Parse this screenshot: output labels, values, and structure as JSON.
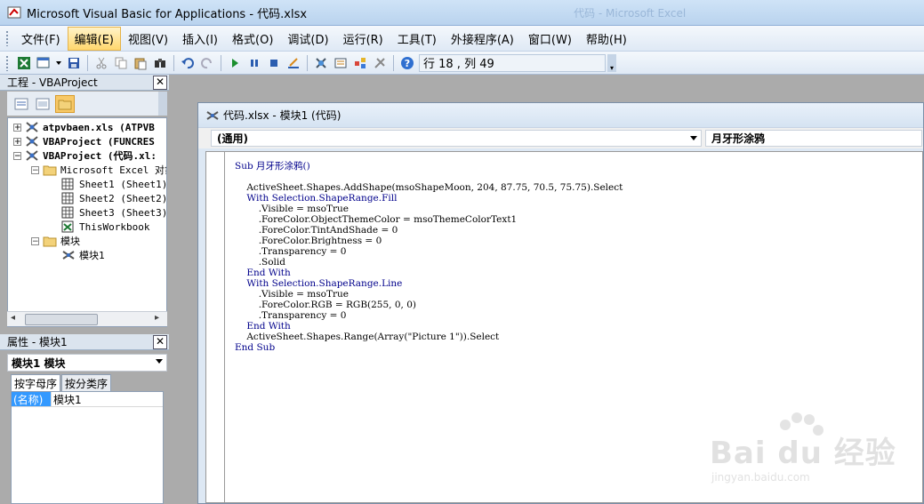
{
  "window": {
    "title": "Microsoft Visual Basic for Applications - 代码.xlsx",
    "ghost_title": "代码 - Microsoft Excel"
  },
  "menu": [
    {
      "label": "文件(F)",
      "active": false
    },
    {
      "label": "编辑(E)",
      "active": true
    },
    {
      "label": "视图(V)",
      "active": false
    },
    {
      "label": "插入(I)",
      "active": false
    },
    {
      "label": "格式(O)",
      "active": false
    },
    {
      "label": "调试(D)",
      "active": false
    },
    {
      "label": "运行(R)",
      "active": false
    },
    {
      "label": "工具(T)",
      "active": false
    },
    {
      "label": "外接程序(A)",
      "active": false
    },
    {
      "label": "窗口(W)",
      "active": false
    },
    {
      "label": "帮助(H)",
      "active": false
    }
  ],
  "toolbar": {
    "status": "行 18 , 列 49"
  },
  "project_pane": {
    "title": "工程 - VBAProject",
    "tree": [
      {
        "label": "atpvbaen.xls (ATPVB",
        "bold": true
      },
      {
        "label": "VBAProject (FUNCRES",
        "bold": true
      },
      {
        "label": "VBAProject (代码.xl:",
        "bold": true
      },
      {
        "label": "Microsoft Excel 对象",
        "bold": false
      },
      {
        "label": "Sheet1 (Sheet1)",
        "bold": false
      },
      {
        "label": "Sheet2 (Sheet2)",
        "bold": false
      },
      {
        "label": "Sheet3 (Sheet3)",
        "bold": false
      },
      {
        "label": "ThisWorkbook",
        "bold": false
      },
      {
        "label": "模块",
        "bold": false
      },
      {
        "label": "模块1",
        "bold": false
      }
    ]
  },
  "properties_pane": {
    "title": "属性 - 模块1",
    "object_combo": "模块1 模块",
    "tabs": [
      {
        "label": "按字母序"
      },
      {
        "label": "按分类序"
      }
    ],
    "rows": [
      {
        "key": "(名称)",
        "value": "模块1"
      }
    ]
  },
  "code_window": {
    "title": "代码.xlsx - 模块1 (代码)",
    "object_combo": "(通用)",
    "proc_combo": "月牙形涂鸦",
    "lines": [
      "Sub 月牙形涂鸦()",
      "",
      "    ActiveSheet.Shapes.AddShape(msoShapeMoon, 204, 87.75, 70.5, 75.75).Select",
      "    With Selection.ShapeRange.Fill",
      "        .Visible = msoTrue",
      "        .ForeColor.ObjectThemeColor = msoThemeColorText1",
      "        .ForeColor.TintAndShade = 0",
      "        .ForeColor.Brightness = 0",
      "        .Transparency = 0",
      "        .Solid",
      "    End With",
      "    With Selection.ShapeRange.Line",
      "        .Visible = msoTrue",
      "        .ForeColor.RGB = RGB(255, 0, 0)",
      "        .Transparency = 0",
      "    End With",
      "    ActiveSheet.Shapes.Range(Array(\"Picture 1\")).Select",
      "End Sub"
    ]
  },
  "watermark": {
    "text": "Bai du 经验",
    "sub": "jingyan.baidu.com"
  }
}
